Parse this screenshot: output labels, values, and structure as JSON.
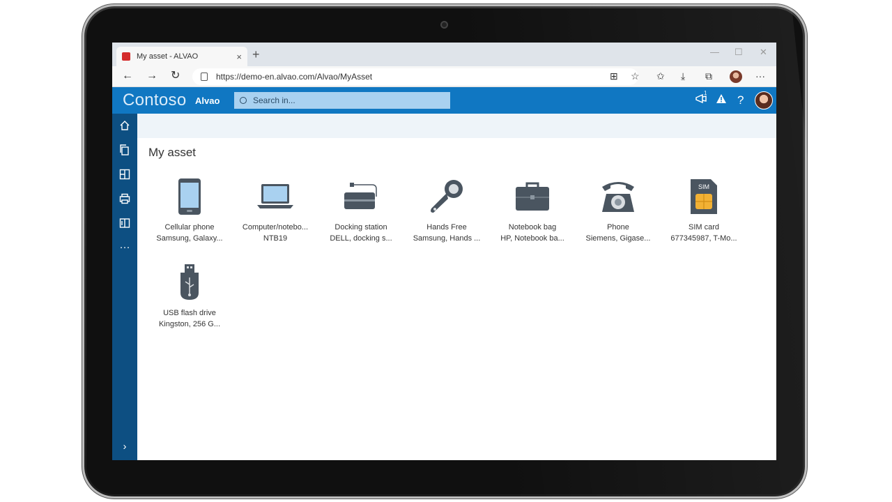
{
  "browser": {
    "tab_title": "My asset - ALVAO",
    "tab_close": "×",
    "new_tab": "+",
    "url": "https://demo-en.alvao.com/Alvao/MyAsset",
    "win_minimize": "—",
    "win_maximize": "☐",
    "win_close": "✕",
    "more": "···"
  },
  "app": {
    "brand": "Contoso",
    "product": "Alvao",
    "search_placeholder": "Search in...",
    "notification_count": "1",
    "help": "?"
  },
  "nav": {
    "more": "···",
    "expand": "›"
  },
  "page": {
    "title": "My asset"
  },
  "assets": [
    {
      "name": "Cellular phone",
      "desc": "Samsung, Galaxy...",
      "icon": "cellular-phone-icon"
    },
    {
      "name": "Computer/notebo...",
      "desc": "NTB19",
      "icon": "laptop-icon"
    },
    {
      "name": "Docking station",
      "desc": "DELL, docking s...",
      "icon": "docking-station-icon"
    },
    {
      "name": "Hands Free",
      "desc": "Samsung, Hands ...",
      "icon": "headset-icon"
    },
    {
      "name": "Notebook bag",
      "desc": "HP, Notebook ba...",
      "icon": "briefcase-icon"
    },
    {
      "name": "Phone",
      "desc": "Siemens, Gigase...",
      "icon": "desk-phone-icon"
    },
    {
      "name": "SIM card",
      "desc": "677345987, T-Mo...",
      "icon": "sim-card-icon"
    },
    {
      "name": "USB flash drive",
      "desc": "Kingston, 256 G...",
      "icon": "usb-drive-icon"
    }
  ],
  "sim_label": "SIM",
  "colors": {
    "header_blue": "#1077c2",
    "nav_dark_blue": "#0d4f82",
    "icon_gray": "#4a5560",
    "sim_gold": "#f2b134"
  }
}
